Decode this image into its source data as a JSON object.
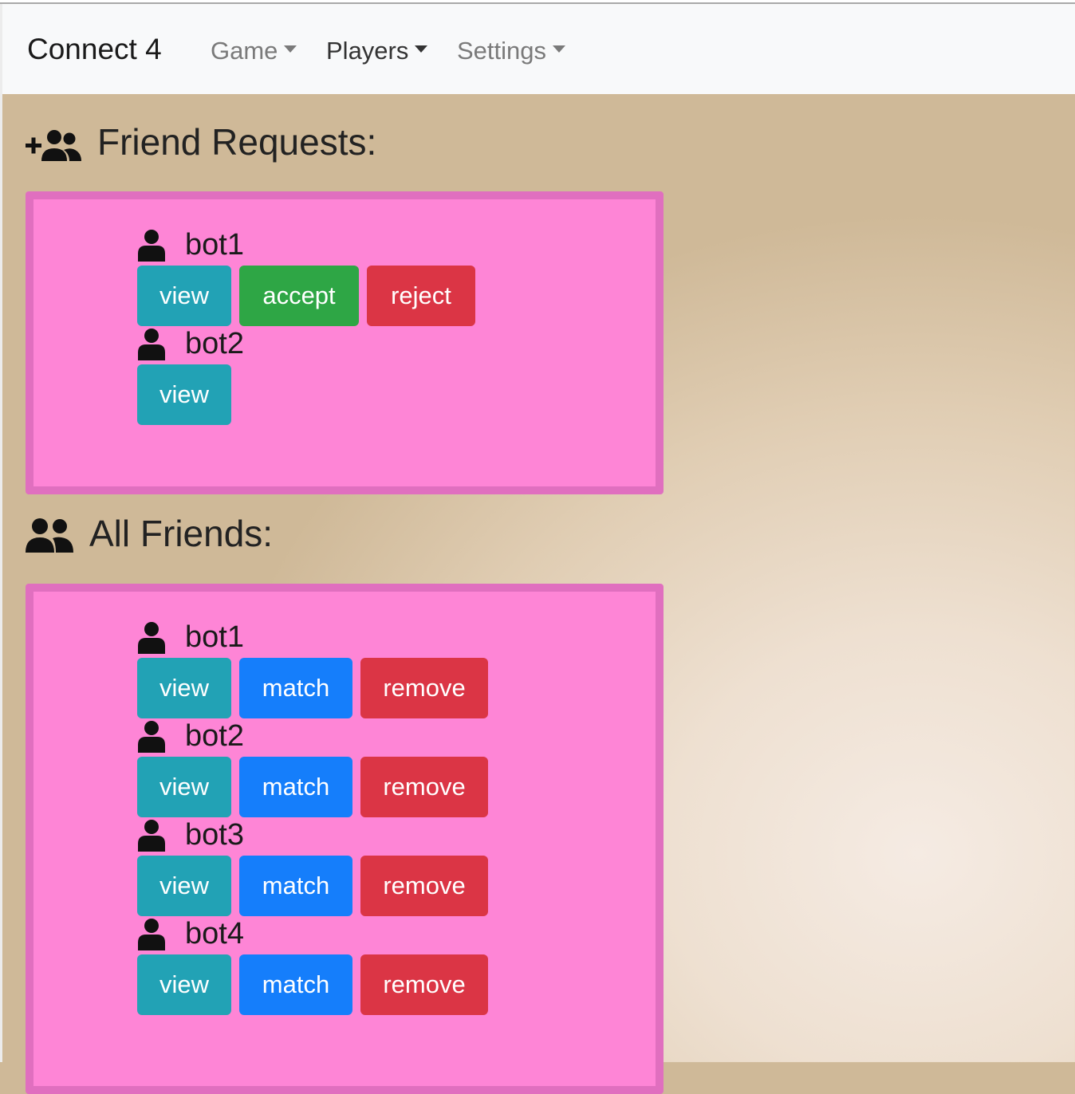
{
  "nav": {
    "brand": "Connect 4",
    "items": [
      {
        "label": "Game",
        "active": false
      },
      {
        "label": "Players",
        "active": true
      },
      {
        "label": "Settings",
        "active": false
      }
    ]
  },
  "requests": {
    "title": "Friend Requests:",
    "icon": "user-plus-icon",
    "entries": [
      {
        "name": "bot1",
        "view": "view",
        "accept": "accept",
        "reject": "reject"
      },
      {
        "name": "bot2",
        "view": "view"
      }
    ]
  },
  "friends": {
    "title": "All Friends:",
    "icon": "users-icon",
    "entries": [
      {
        "name": "bot1",
        "view": "view",
        "match": "match",
        "remove": "remove"
      },
      {
        "name": "bot2",
        "view": "view",
        "match": "match",
        "remove": "remove"
      },
      {
        "name": "bot3",
        "view": "view",
        "match": "match",
        "remove": "remove"
      },
      {
        "name": "bot4",
        "view": "view",
        "match": "match",
        "remove": "remove"
      }
    ]
  },
  "colors": {
    "panel": "#fe85d6",
    "panel_border": "#e06fbf",
    "info": "#22a2b5",
    "success": "#2ea645",
    "danger": "#db3545",
    "primary": "#157efb"
  }
}
